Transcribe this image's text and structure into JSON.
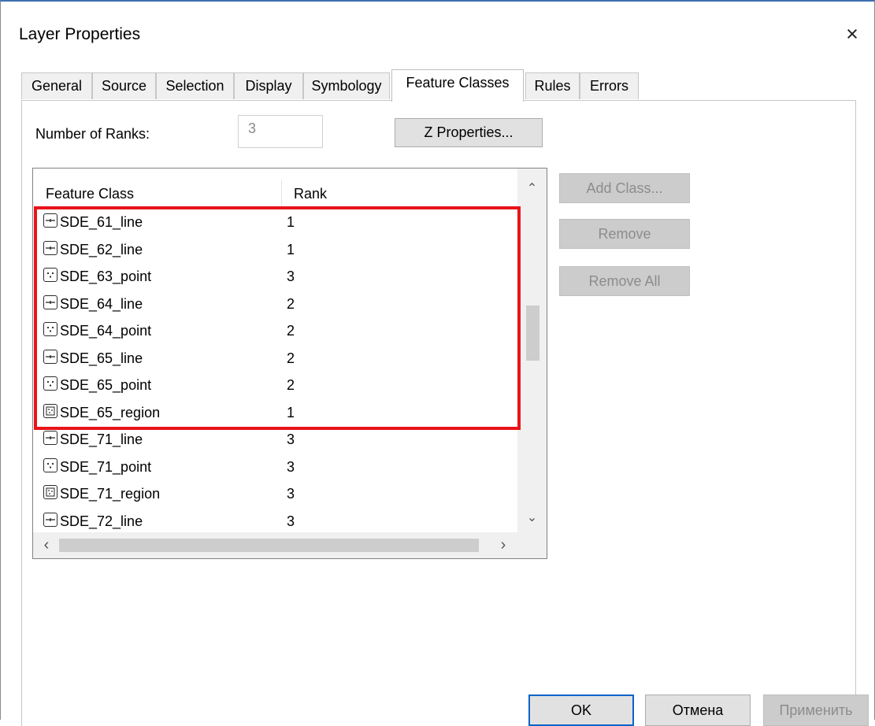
{
  "window": {
    "title": "Layer Properties",
    "close_glyph": "×"
  },
  "tabs": [
    {
      "label": "General"
    },
    {
      "label": "Source"
    },
    {
      "label": "Selection"
    },
    {
      "label": "Display"
    },
    {
      "label": "Symbology"
    },
    {
      "label": "Feature Classes",
      "active": true
    },
    {
      "label": "Rules"
    },
    {
      "label": "Errors"
    }
  ],
  "ranks": {
    "label": "Number of Ranks:",
    "value": "3"
  },
  "buttons": {
    "z_properties": "Z Properties...",
    "add_class": "Add Class...",
    "remove": "Remove",
    "remove_all": "Remove All",
    "ok": "OK",
    "cancel": "Отмена",
    "apply": "Применить"
  },
  "table": {
    "columns": [
      "Feature Class",
      "Rank"
    ],
    "rows": [
      {
        "name": "SDE_61_line",
        "rank": "1",
        "icon": "line-feature-icon"
      },
      {
        "name": "SDE_62_line",
        "rank": "1",
        "icon": "line-feature-icon"
      },
      {
        "name": "SDE_63_point",
        "rank": "3",
        "icon": "point-feature-icon"
      },
      {
        "name": "SDE_64_line",
        "rank": "2",
        "icon": "line-feature-icon"
      },
      {
        "name": "SDE_64_point",
        "rank": "2",
        "icon": "point-feature-icon"
      },
      {
        "name": "SDE_65_line",
        "rank": "2",
        "icon": "line-feature-icon"
      },
      {
        "name": "SDE_65_point",
        "rank": "2",
        "icon": "point-feature-icon"
      },
      {
        "name": "SDE_65_region",
        "rank": "1",
        "icon": "region-feature-icon"
      },
      {
        "name": "SDE_71_line",
        "rank": "3",
        "icon": "line-feature-icon"
      },
      {
        "name": "SDE_71_point",
        "rank": "3",
        "icon": "point-feature-icon"
      },
      {
        "name": "SDE_71_region",
        "rank": "3",
        "icon": "region-feature-icon"
      },
      {
        "name": "SDE_72_line",
        "rank": "3",
        "icon": "line-feature-icon"
      }
    ]
  },
  "colors": {
    "highlight": "#e8141a",
    "ok_border": "#0a64c8",
    "disabled_text": "#8c8c8c"
  }
}
